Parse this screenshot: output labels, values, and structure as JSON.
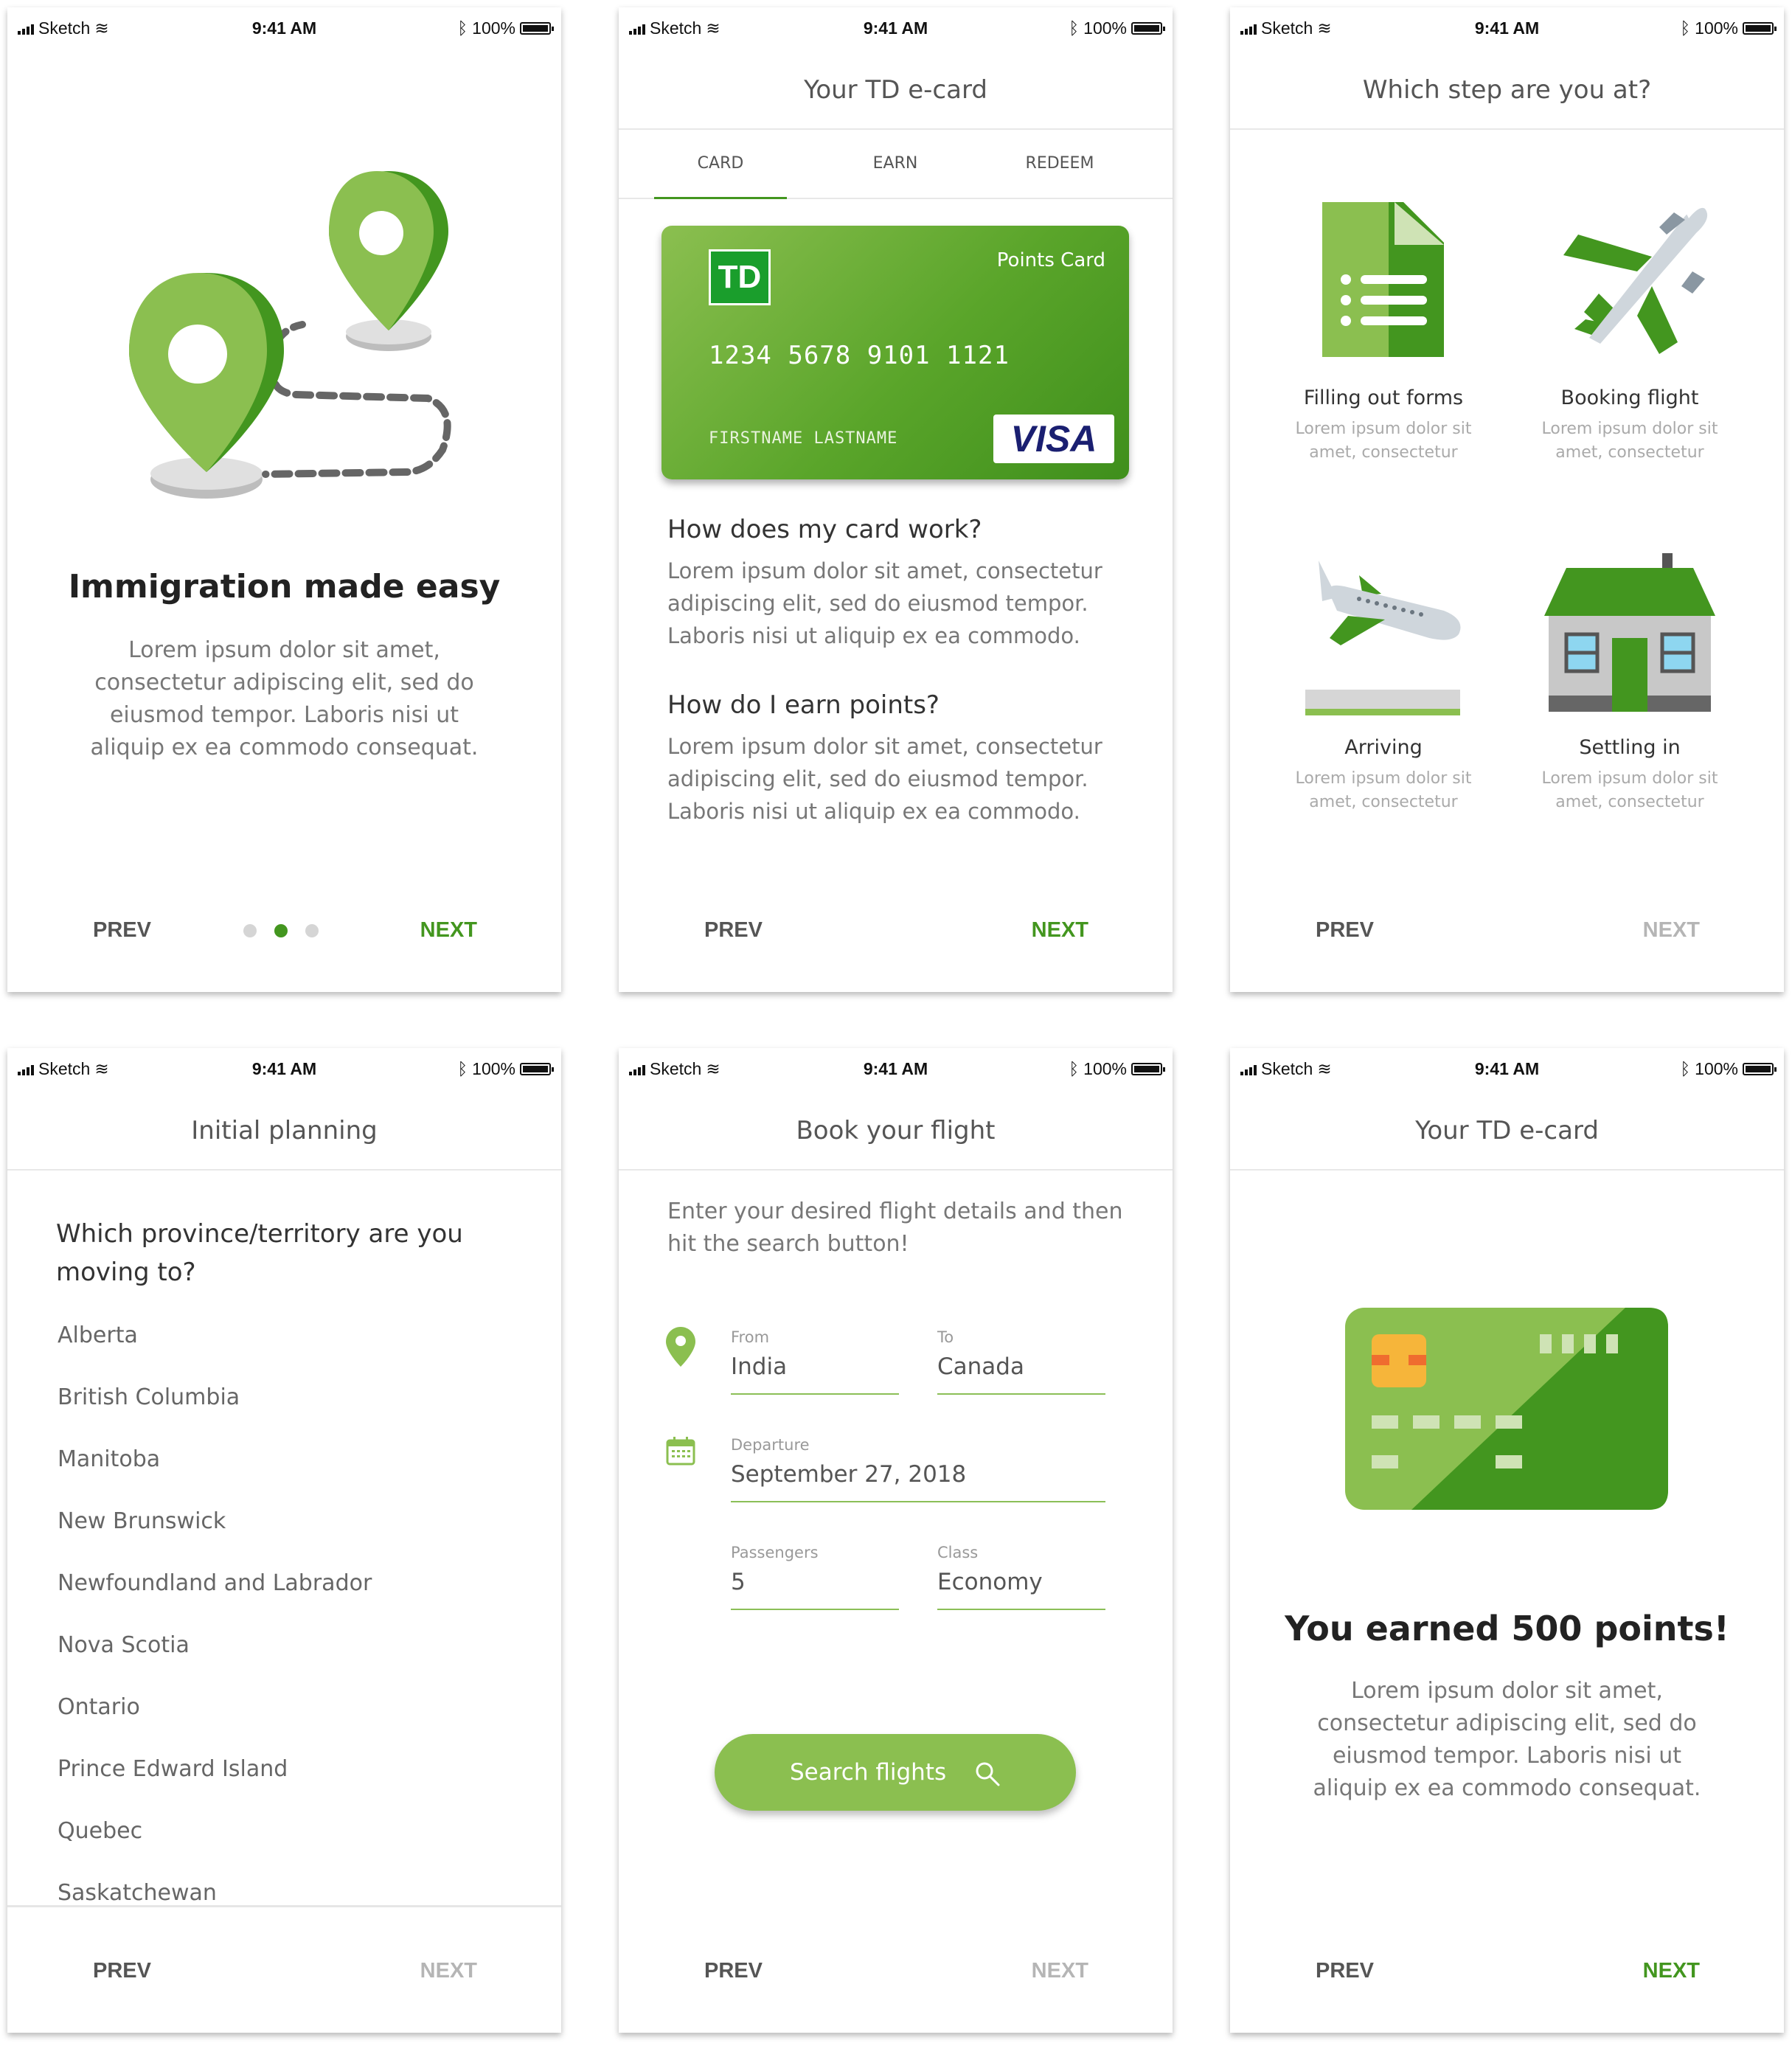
{
  "status_bar": {
    "carrier": "Sketch",
    "time": "9:41 AM",
    "battery": "100%"
  },
  "screen1": {
    "title": "Immigration made easy",
    "body": "Lorem ipsum dolor sit amet, consectetur adipiscing elit, sed do eiusmod tempor. Laboris nisi ut aliquip ex ea commodo consequat.",
    "prev": "PREV",
    "next": "NEXT"
  },
  "screen2": {
    "header": "Your TD e-card",
    "tabs": [
      "CARD",
      "EARN",
      "REDEEM"
    ],
    "card": {
      "logo": "TD",
      "type": "Points Card",
      "number": "1234 5678 9101 1121",
      "name": "FIRSTNAME LASTNAME",
      "network": "VISA"
    },
    "q1": "How does my card work?",
    "a1": "Lorem ipsum dolor sit amet, consectetur adipiscing elit, sed do eiusmod tempor. Laboris nisi ut aliquip ex ea commodo.",
    "q2": "How do I earn points?",
    "a2": "Lorem ipsum dolor sit amet, consectetur adipiscing elit, sed do eiusmod tempor. Laboris nisi ut aliquip ex ea commodo.",
    "prev": "PREV",
    "next": "NEXT"
  },
  "screen3": {
    "header": "Which step are you at?",
    "steps": [
      {
        "title": "Filling out forms",
        "sub": "Lorem ipsum dolor sit amet, consectetur"
      },
      {
        "title": "Booking flight",
        "sub": "Lorem ipsum dolor sit amet, consectetur"
      },
      {
        "title": "Arriving",
        "sub": "Lorem ipsum dolor sit amet, consectetur"
      },
      {
        "title": "Settling in",
        "sub": "Lorem ipsum dolor sit amet, consectetur"
      }
    ],
    "prev": "PREV",
    "next": "NEXT"
  },
  "screen4": {
    "header": "Initial planning",
    "question": "Which province/territory are you moving to?",
    "provinces": [
      "Alberta",
      "British Columbia",
      "Manitoba",
      "New Brunswick",
      "Newfoundland and Labrador",
      "Nova Scotia",
      "Ontario",
      "Prince Edward Island",
      "Quebec",
      "Saskatchewan"
    ],
    "prev": "PREV",
    "next": "NEXT"
  },
  "screen5": {
    "header": "Book your flight",
    "intro": "Enter your desired flight details and then hit the search button!",
    "from_label": "From",
    "from_value": "India",
    "to_label": "To",
    "to_value": "Canada",
    "departure_label": "Departure",
    "departure_value": "September 27, 2018",
    "passengers_label": "Passengers",
    "passengers_value": "5",
    "class_label": "Class",
    "class_value": "Economy",
    "search": "Search flights",
    "prev": "PREV",
    "next": "NEXT"
  },
  "screen6": {
    "header": "Your TD e-card",
    "title": "You earned 500 points!",
    "body": "Lorem ipsum dolor sit amet, consectetur adipiscing elit, sed do eiusmod tempor. Laboris nisi ut aliquip ex ea commodo consequat.",
    "prev": "PREV",
    "next": "NEXT"
  },
  "colors": {
    "accent": "#43961f",
    "light_green": "#8bbf50",
    "grey": "#666666"
  }
}
